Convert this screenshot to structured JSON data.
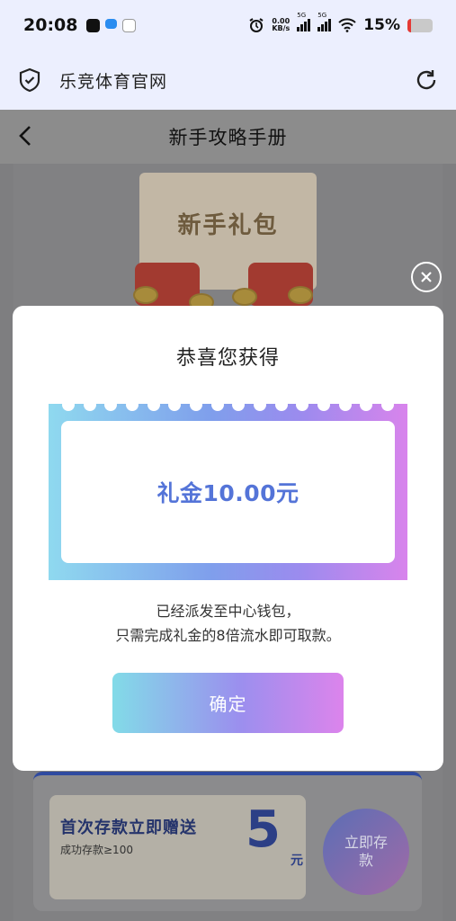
{
  "status_bar": {
    "time": "20:08",
    "net_speed": "0.00\nKB/s",
    "signal_1": "5G",
    "signal_2": "5G",
    "battery": "15%",
    "battery_level": 0.15
  },
  "browser": {
    "title": "乐竞体育官网"
  },
  "page": {
    "title": "新手攻略手册",
    "gift_label": "新手礼包"
  },
  "modal": {
    "title": "恭喜您获得",
    "bonus": "礼金10.00元",
    "note_line1": "已经派发至中心钱包，",
    "note_line2": "只需完成礼金的8倍流水即可取款。",
    "confirm_label": "确定"
  },
  "promo": {
    "title": "首次存款立即赠送",
    "subtitle": "成功存款≥100",
    "amount": "5",
    "unit": "元",
    "button_label": "立即存款"
  },
  "colors": {
    "accent_text": "#5474d8",
    "gradient_start": "#82dbe8",
    "gradient_end": "#dc84ec"
  }
}
